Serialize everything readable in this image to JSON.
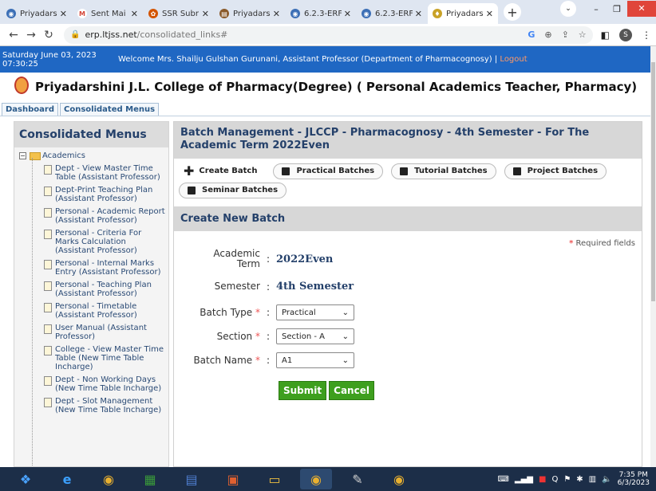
{
  "browser": {
    "tabs": [
      {
        "label": "Priyadars",
        "color": "#3c6fb6"
      },
      {
        "label": "Sent Mai",
        "color": "#d44638"
      },
      {
        "label": "SSR Subr",
        "color": "#d35400"
      },
      {
        "label": "Priyadars",
        "color": "#8a5a2a"
      },
      {
        "label": "6.2.3-ERF",
        "color": "#3c6fb6"
      },
      {
        "label": "6.2.3-ERF",
        "color": "#3c6fb6"
      },
      {
        "label": "Priyadars",
        "color": "#c9a227"
      }
    ],
    "url_host": "erp.ltjss.net",
    "url_path": "/consolidated_links#",
    "avatar_letter": "S"
  },
  "header": {
    "date": "Saturday June 03, 2023 07:30:25",
    "welcome": "Welcome Mrs. Shailju Gulshan Gurunani, Assistant Professor (Department of Pharmacognosy) |",
    "logout": "Logout",
    "title": "Priyadarshini J.L. College of Pharmacy(Degree)  ( Personal Academics Teacher, Pharmacy)"
  },
  "topnav": {
    "dashboard": "Dashboard",
    "consolidated": "Consolidated Menus"
  },
  "sidebar": {
    "heading": "Consolidated Menus",
    "root": "Academics",
    "items": [
      {
        "label": "Dept - View Master Time Table (Assistant Professor)"
      },
      {
        "label": "Dept-Print Teaching Plan (Assistant Professor)"
      },
      {
        "label": "Personal - Academic Report (Assistant Professor)"
      },
      {
        "label": "Personal - Criteria For Marks Calculation (Assistant Professor)"
      },
      {
        "label": "Personal - Internal Marks Entry (Assistant Professor)"
      },
      {
        "label": "Personal - Teaching Plan (Assistant Professor)"
      },
      {
        "label": "Personal - Timetable (Assistant Professor)"
      },
      {
        "label": "User Manual (Assistant Professor)"
      },
      {
        "label": "College - View Master Time Table (New Time Table Incharge)"
      },
      {
        "label": "Dept - Non Working Days (New Time Table Incharge)"
      },
      {
        "label": "Dept - Slot Management (New Time Table Incharge)"
      }
    ]
  },
  "main": {
    "heading": "Batch Management - JLCCP - Pharmacognosy - 4th Semester - For The Academic Term 2022Even",
    "buttons": {
      "create": "Create Batch",
      "practical": "Practical Batches",
      "tutorial": "Tutorial Batches",
      "project": "Project Batches",
      "seminar": "Seminar Batches"
    },
    "form_heading": "Create New Batch",
    "required": "Required fields",
    "academic_label": "Academic Term",
    "academic_value": "2022Even",
    "semester_label": "Semester",
    "semester_value": "4th Semester",
    "batch_type_label": "Batch Type",
    "batch_type_value": "Practical",
    "section_label": "Section",
    "section_value": "Section - A",
    "batch_name_label": "Batch Name",
    "batch_name_value": "A1",
    "submit": "Submit",
    "cancel": "Cancel"
  },
  "taskbar": {
    "time": "7:35 PM",
    "date": "6/3/2023"
  }
}
